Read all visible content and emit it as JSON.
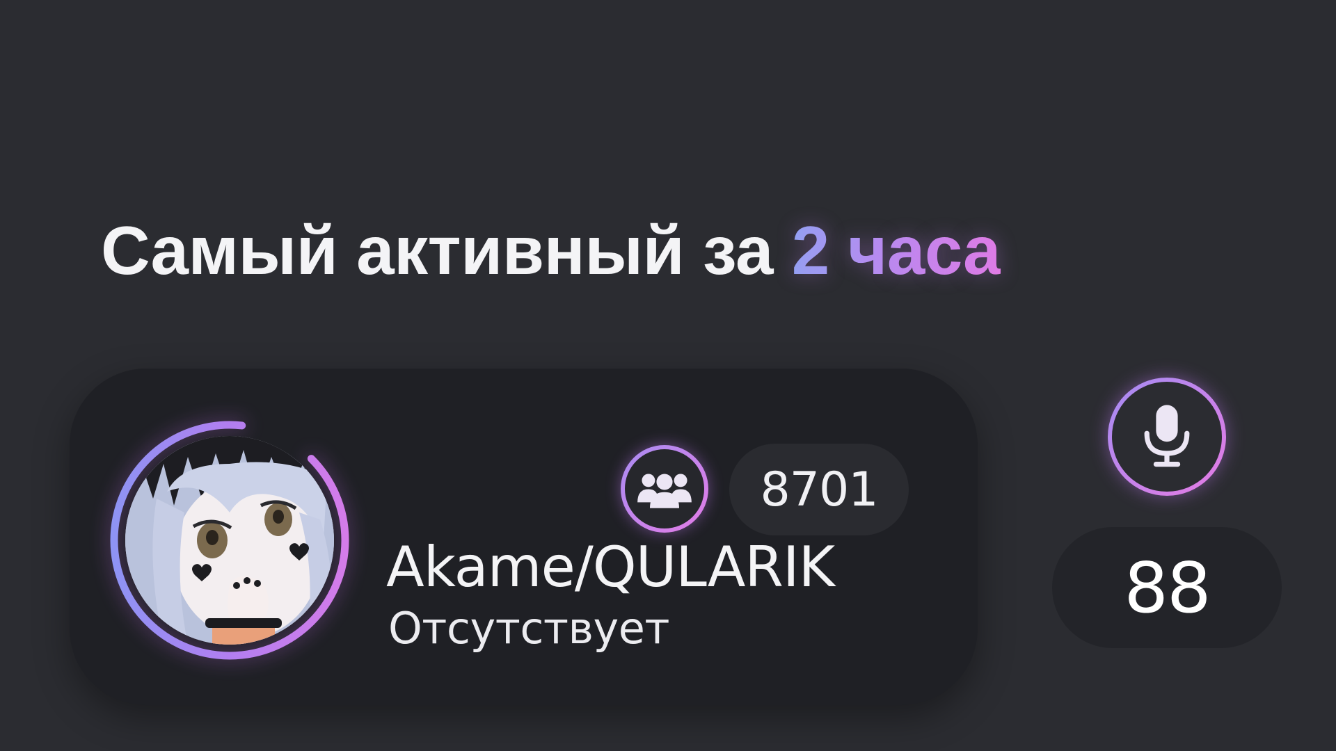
{
  "heading": {
    "text": "Самый активный за ",
    "accent": "2 часа"
  },
  "user": {
    "name": "Akame/QULARIK",
    "status": "Отсутствует",
    "avatar": "anime-avatar"
  },
  "members": {
    "icon": "people-group-icon",
    "count": "8701"
  },
  "voice": {
    "icon": "microphone-icon",
    "count": "88"
  },
  "colors": {
    "background": "#2b2c31",
    "card": "#1f2025",
    "accent_start": "#8fa4f3",
    "accent_end": "#e47be4"
  }
}
